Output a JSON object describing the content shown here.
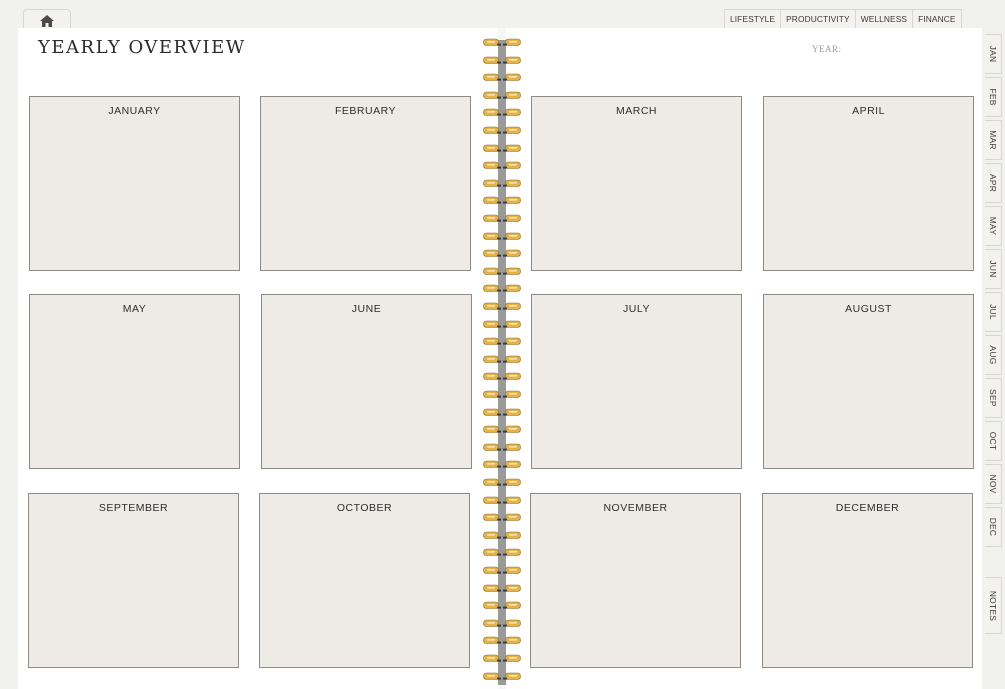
{
  "header": {
    "home_icon": "home-icon",
    "tabs": [
      "LIFESTYLE",
      "PRODUCTIVITY",
      "WELLNESS",
      "FINANCE"
    ]
  },
  "page": {
    "title": "YEARLY OVERVIEW",
    "year_label": "YEAR:"
  },
  "months": [
    "JANUARY",
    "FEBRUARY",
    "MARCH",
    "APRIL",
    "MAY",
    "JUNE",
    "JULY",
    "AUGUST",
    "SEPTEMBER",
    "OCTOBER",
    "NOVEMBER",
    "DECEMBER"
  ],
  "side_tabs": [
    "JAN",
    "FEB",
    "MAR",
    "APR",
    "MAY",
    "JUN",
    "JUL",
    "AUG",
    "SEP",
    "OCT",
    "NOV",
    "DEC",
    "NOTES"
  ],
  "colors": {
    "background": "#f1f1f0",
    "page": "#ffffff",
    "box_fill": "#eeeae5",
    "box_border": "#8e8b86",
    "ring_gold": "#e2b24b",
    "spine": "#9a9a99"
  }
}
